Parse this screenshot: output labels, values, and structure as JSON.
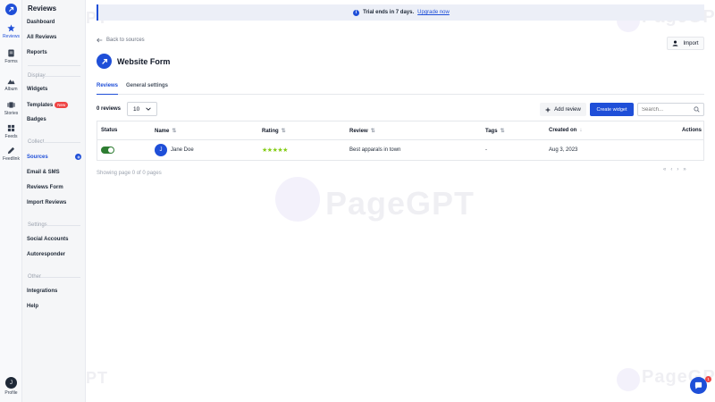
{
  "rail": {
    "items": [
      {
        "label": "Reviews"
      },
      {
        "label": "Forms"
      },
      {
        "label": "Album"
      },
      {
        "label": "Stories"
      },
      {
        "label": "Feeds"
      },
      {
        "label": "Feedlink"
      }
    ],
    "profile_initial": "J",
    "profile_label": "Profile"
  },
  "sidebar": {
    "title": "Reviews",
    "items": {
      "dashboard": "Dashboard",
      "all_reviews": "All Reviews",
      "reports": "Reports",
      "display_header": "Display",
      "widgets": "Widgets",
      "templates": "Templates",
      "templates_badge": "New",
      "badges": "Badges",
      "collect_header": "Collect",
      "sources": "Sources",
      "email_sms": "Email & SMS",
      "reviews_form": "Reviews Form",
      "import_reviews": "Import Reviews",
      "settings_header": "Settings",
      "social_accounts": "Social Accounts",
      "autoresponder": "Autoresponder",
      "other_header": "Other",
      "integrations": "Integrations",
      "help": "Help"
    }
  },
  "trial": {
    "text": "Trial ends in 7 days.",
    "link": "Upgrade now"
  },
  "header": {
    "back": "Back to sources",
    "import": "Import",
    "title": "Website Form"
  },
  "tabs": [
    "Reviews",
    "General settings"
  ],
  "toolbar": {
    "count": "0 reviews",
    "page_size": "10",
    "add_review": "Add review",
    "create_widget": "Create widget",
    "search_placeholder": "Search..."
  },
  "table": {
    "columns": [
      "Status",
      "Name",
      "Rating",
      "Review",
      "Tags",
      "Created on",
      "Actions"
    ],
    "rows": [
      {
        "initial": "J",
        "name": "Jane Doe",
        "rating": 5,
        "review": "Best apparals in town",
        "tags": "-",
        "created_on": "Aug 3, 2023"
      }
    ]
  },
  "footer": {
    "showing": "Showing page 0 of 0 pages"
  },
  "chat": {
    "badge": "1"
  },
  "watermark": "PageGPT",
  "colors": {
    "accent": "#1f4fd8",
    "toggle": "#2e7d32",
    "stars": "#84cc16",
    "badge": "#ef4444"
  }
}
